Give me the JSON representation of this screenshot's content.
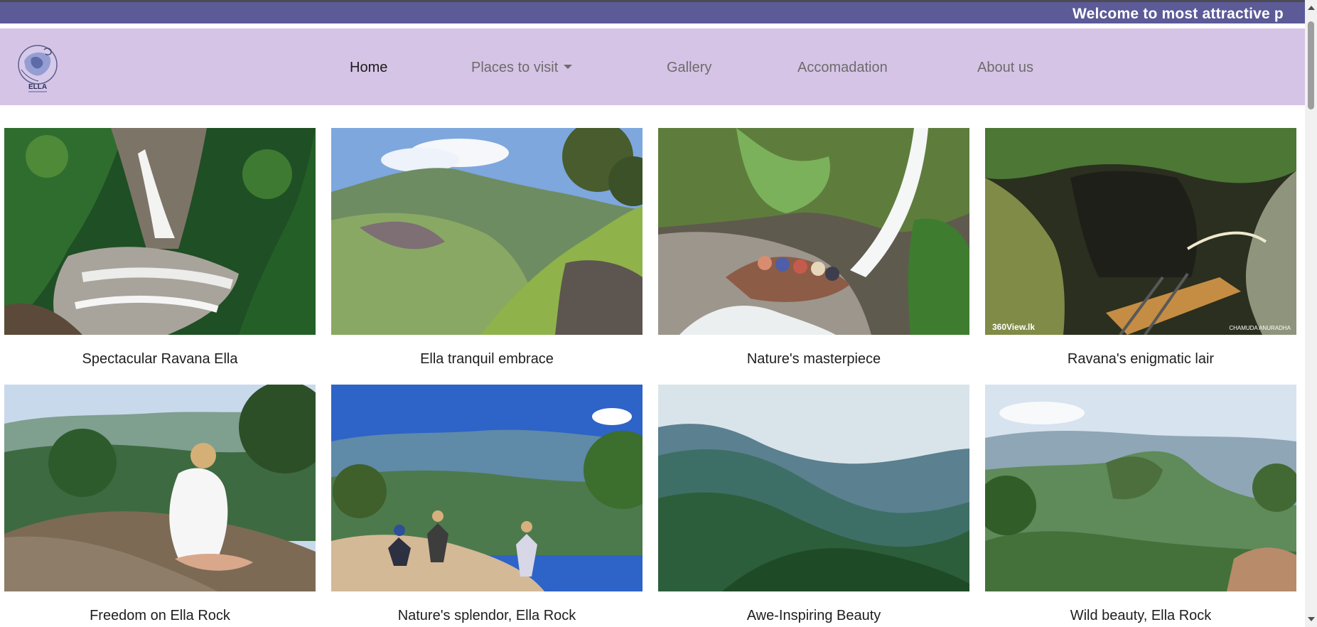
{
  "marquee": {
    "text": "Welcome to most attractive p"
  },
  "logo": {
    "text": "ELLA"
  },
  "nav": {
    "home": "Home",
    "places": "Places to visit",
    "gallery": "Gallery",
    "accommodation": "Accomadation",
    "about": "About us"
  },
  "gallery": {
    "items": [
      {
        "caption": "Spectacular Ravana Ella"
      },
      {
        "caption": "Ella tranquil embrace"
      },
      {
        "caption": "Nature's masterpiece"
      },
      {
        "caption": "Ravana's enigmatic lair"
      },
      {
        "caption": "Freedom on Ella Rock"
      },
      {
        "caption": "Nature's splendor, Ella Rock"
      },
      {
        "caption": "Awe-Inspiring Beauty"
      },
      {
        "caption": "Wild beauty, Ella Rock"
      }
    ],
    "watermarks": {
      "left": "360View.lk",
      "right": "CHAMUDA ANURADHA"
    }
  },
  "colors": {
    "marquee_bg": "#5c5a97",
    "navbar_bg": "#d6c4e6"
  }
}
